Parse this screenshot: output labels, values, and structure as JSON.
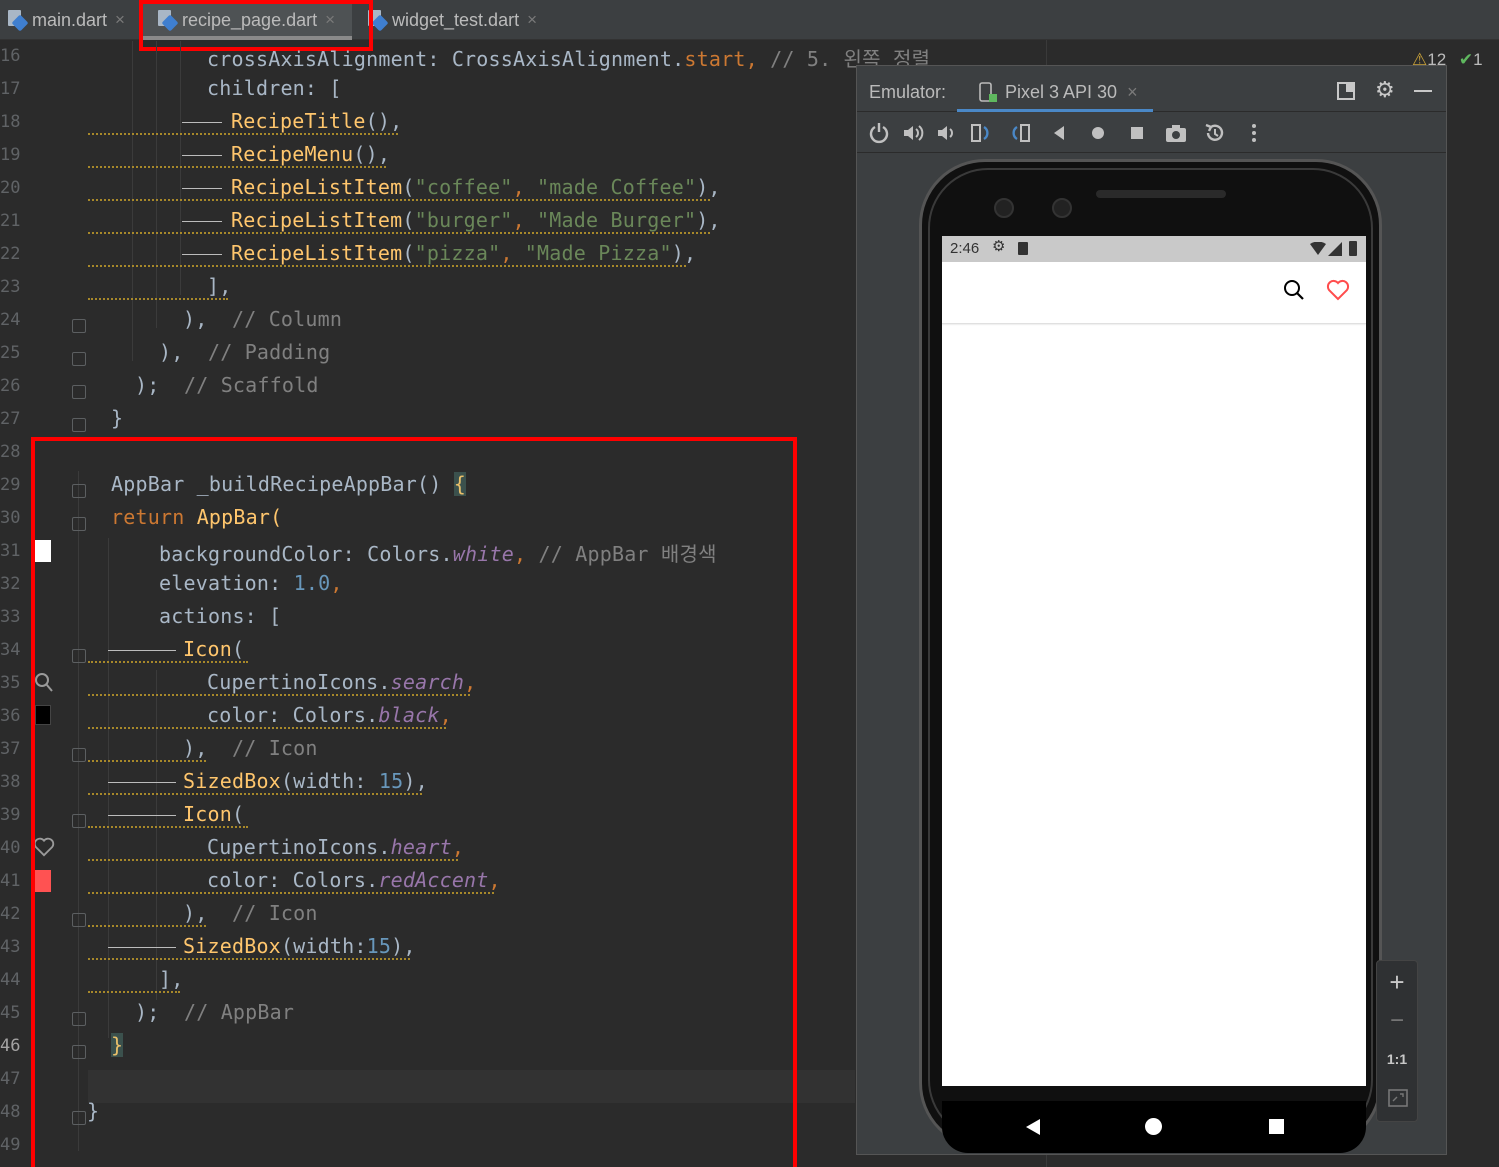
{
  "tabs": [
    {
      "label": "main.dart",
      "close": "×"
    },
    {
      "label": "recipe_page.dart",
      "close": "×"
    },
    {
      "label": "widget_test.dart",
      "close": "×"
    }
  ],
  "status": {
    "warnings": "12",
    "checks": "1"
  },
  "line_numbers": [
    "16",
    "17",
    "18",
    "19",
    "20",
    "21",
    "22",
    "23",
    "24",
    "25",
    "26",
    "27",
    "28",
    "29",
    "30",
    "31",
    "32",
    "33",
    "34",
    "35",
    "36",
    "37",
    "38",
    "39",
    "40",
    "41",
    "42",
    "43",
    "44",
    "45",
    "46",
    "47",
    "48",
    "49"
  ],
  "code": {
    "l16a": "crossAxisAlignment: CrossAxisAlignment.",
    "l16b": "start",
    ",": ",",
    "l16c": " // 5. 왼쪽 정렬",
    "l17a": "children: ",
    "l17b": "[",
    "l18a": "RecipeTitle",
    "l18b": "(),",
    "l19a": "RecipeMenu",
    "l19b": "(),",
    "l20a": "RecipeListItem",
    "l20b": "(",
    "l20c": "\"coffee\"",
    "l20d": ", ",
    "l20e": "\"made Coffee\"",
    "l20f": "),",
    "l21a": "RecipeListItem",
    "l21b": "(",
    "l21c": "\"burger\"",
    "l21d": ", ",
    "l21e": "\"Made Burger\"",
    "l21f": "),",
    "l22a": "RecipeListItem",
    "l22b": "(",
    "l22c": "\"pizza\"",
    "l22d": ", ",
    "l22e": "\"Made Pizza\"",
    "l22f": "),",
    "l23a": "],",
    "l24a": "),",
    "l24b": "  // Column",
    "l25a": "),",
    "l25b": "  // Padding",
    "l26a": ");",
    "l26b": "  // Scaffold",
    "l27a": "}",
    "l29a": "AppBar _buildRecipeAppBar() ",
    "l29b": "{",
    "l30a": "return ",
    "l30b": "AppBar(",
    "l31a": "backgroundColor: Colors.",
    "l31b": "white",
    "l31c": ",",
    "l31d": " // AppBar 배경색",
    "l32a": "elevation: ",
    "l32b": "1.0",
    "l32c": ",",
    "l33a": "actions: ",
    "l33b": "[",
    "l34a": "Icon",
    "l34b": "(",
    "l35a": "CupertinoIcons.",
    "l35b": "search",
    "l35c": ",",
    "l36a": "color: Colors.",
    "l36b": "black",
    "l36c": ",",
    "l37a": "),",
    "l37b": "  // Icon",
    "l38a": "SizedBox",
    "l38b": "(width: ",
    "l38c": "15",
    "l38d": "),",
    "l39a": "Icon",
    "l39b": "(",
    "l40a": "CupertinoIcons.",
    "l40b": "heart",
    "l40c": ",",
    "l41a": "color: Colors.",
    "l41b": "redAccent",
    "l41c": ",",
    "l42a": "),",
    "l42b": "  // Icon",
    "l43a": "SizedBox",
    "l43b": "(width:",
    "l43c": "15",
    "l43d": "),",
    "l44a": "],",
    "l45a": ");",
    "l45b": "  // AppBar",
    "l46a": "}",
    "l48a": "}"
  },
  "emulator": {
    "label": "Emulator:",
    "device_tab": "Pixel 3 API 30",
    "close": "×"
  },
  "phone": {
    "time": "2:46"
  },
  "zoom": {
    "plus": "+",
    "minus": "−",
    "ratio": "1:1"
  },
  "colors": {
    "highlight_red": "#ff0000",
    "accent": "#4a88c7",
    "heart": "#ff4d4d"
  }
}
